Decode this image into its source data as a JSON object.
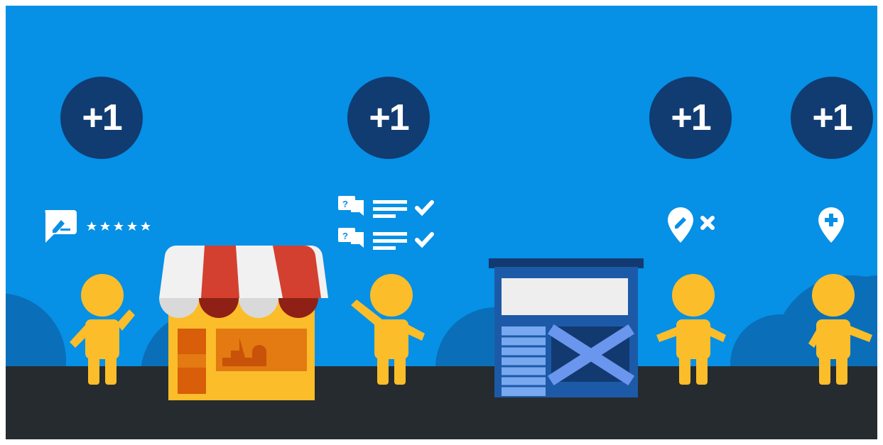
{
  "badges": [
    {
      "label": "+1"
    },
    {
      "label": "+1"
    },
    {
      "label": "+1"
    },
    {
      "label": "+1"
    }
  ],
  "icons": {
    "review": "review-icon",
    "stars": "five-stars-icon",
    "question_answer": "question-answer-icon",
    "edit_place": "edit-place-icon",
    "add_place": "add-place-icon"
  },
  "colors": {
    "sky": "#0690e6",
    "badge": "#113c71",
    "ground": "#262b2f",
    "person": "#fbbd2a",
    "shop_red": "#d4402f",
    "building_dark": "#123a70"
  }
}
